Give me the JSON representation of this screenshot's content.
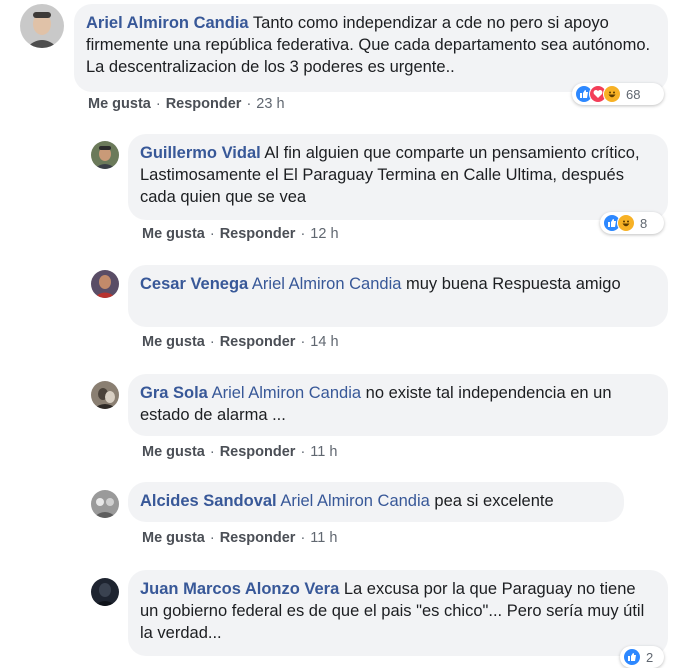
{
  "comments": [
    {
      "author": "Ariel Almiron Candia",
      "mention": "",
      "text": "Tanto como independizar a cde no pero si apoyo firmemente una república federativa. Que cada departamento sea autónomo. La descentralizacion de los 3 poderes es urgente..",
      "like": "Me gusta",
      "reply": "Responder",
      "time": "23 h",
      "reaction_count": "68",
      "reaction_icons": [
        "like-icon",
        "love-icon",
        "haha-icon"
      ]
    },
    {
      "author": "Guillermo Vidal",
      "mention": "",
      "text": "Al fin alguien que comparte un pensamiento crítico, Lastimosamente el El Paraguay Termina en Calle Ultima, después cada quien que se vea",
      "like": "Me gusta",
      "reply": "Responder",
      "time": "12 h",
      "reaction_count": "8",
      "reaction_icons": [
        "like-icon",
        "haha-icon"
      ]
    },
    {
      "author": "Cesar Venega",
      "mention": "Ariel Almiron Candia",
      "text": "muy buena Respuesta amigo",
      "like": "Me gusta",
      "reply": "Responder",
      "time": "14 h"
    },
    {
      "author": "Gra Sola",
      "mention": "Ariel Almiron Candia",
      "text": "no existe tal independencia en un estado de alarma ...",
      "like": "Me gusta",
      "reply": "Responder",
      "time": "11 h"
    },
    {
      "author": "Alcides Sandoval",
      "mention": "Ariel Almiron Candia",
      "text": "pea si excelente",
      "like": "Me gusta",
      "reply": "Responder",
      "time": "11 h"
    },
    {
      "author": "Juan Marcos Alonzo Vera",
      "mention": "",
      "text": "La excusa por la que Paraguay no tiene un gobierno federal es de que el pais \"es chico\"... Pero sería muy útil la verdad...",
      "reaction_count": "2",
      "reaction_icons": [
        "like-icon"
      ]
    }
  ],
  "separator": "·"
}
